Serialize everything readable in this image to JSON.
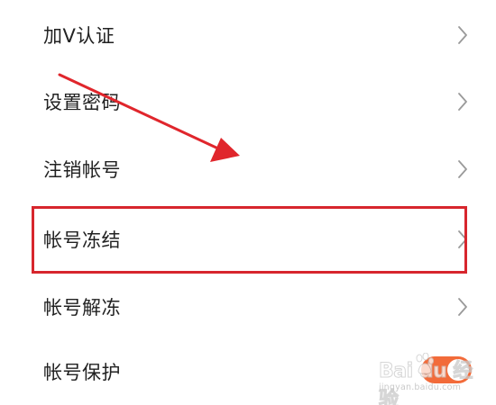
{
  "settings_list": {
    "items": [
      {
        "label": "加V认证"
      },
      {
        "label": "设置密码"
      },
      {
        "label": "注销帐号"
      },
      {
        "label": "帐号冻结"
      },
      {
        "label": "帐号解冻"
      },
      {
        "label": "帐号保护"
      }
    ],
    "highlighted_item": "帐号冻结"
  },
  "account_protection_toggle": {
    "state": "on",
    "color": "#f26b3a"
  },
  "annotation": {
    "arrow_color": "#e0262c",
    "box_color": "#d7262d"
  },
  "watermark": {
    "brand": "Bai du 经验",
    "url": "jingyan.baidu.com"
  },
  "icons": {
    "chevron": "chevron-right-icon",
    "watermark_logo": "baidu-paw-icon"
  }
}
